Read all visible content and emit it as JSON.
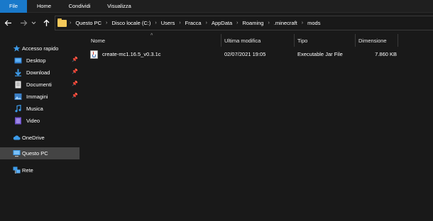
{
  "ribbon": {
    "tabs": [
      {
        "label": "File",
        "active": true
      },
      {
        "label": "Home"
      },
      {
        "label": "Condividi"
      },
      {
        "label": "Visualizza"
      }
    ],
    "accent_color": "#1979ca"
  },
  "navigation": {
    "back_icon": "arrow-left",
    "forward_icon": "arrow-right",
    "recent_icon": "chevron-down",
    "up_icon": "arrow-up"
  },
  "address_bar": {
    "folder_icon": "folder",
    "crumbs": [
      "Questo PC",
      "Disco locale (C:)",
      "Users",
      "Fracca",
      "AppData",
      "Roaming",
      ".minecraft",
      "mods"
    ]
  },
  "sidebar": {
    "items": [
      {
        "label": "Accesso rapido",
        "icon": "star",
        "pinned": false
      },
      {
        "label": "Desktop",
        "icon": "desktop-folder",
        "pinned": true
      },
      {
        "label": "Download",
        "icon": "download-arrow",
        "pinned": true
      },
      {
        "label": "Documenti",
        "icon": "document",
        "pinned": true
      },
      {
        "label": "Immagini",
        "icon": "pictures",
        "pinned": true
      },
      {
        "label": "Musica",
        "icon": "music-note",
        "pinned": false
      },
      {
        "label": "Video",
        "icon": "video",
        "pinned": false
      },
      {
        "label": "OneDrive",
        "icon": "cloud",
        "pinned": false
      },
      {
        "label": "Questo PC",
        "icon": "computer",
        "pinned": false,
        "selected": true
      },
      {
        "label": "Rete",
        "icon": "network",
        "pinned": false
      }
    ]
  },
  "file_list": {
    "columns": [
      "Nome",
      "Ultima modifica",
      "Tipo",
      "Dimensione"
    ],
    "sorted_by": "Nome",
    "rows": [
      {
        "name": "create-mc1.16.5_v0.3.1c",
        "modified": "02/07/2021 19:05",
        "type": "Executable Jar File",
        "size": "7.860 KB",
        "icon": "java-jar"
      }
    ]
  }
}
